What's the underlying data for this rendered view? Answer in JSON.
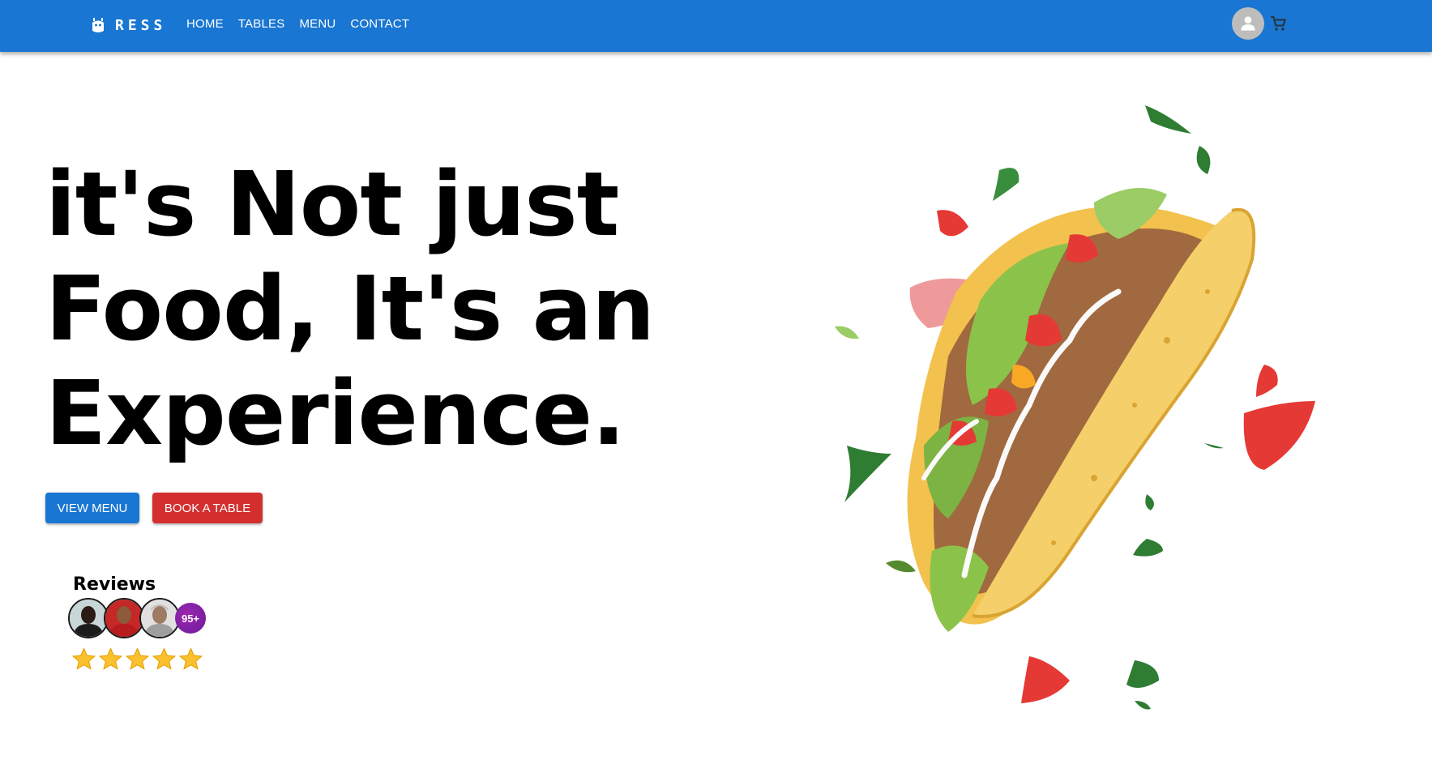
{
  "header": {
    "brand": "RESS",
    "nav": [
      "HOME",
      "TABLES",
      "MENU",
      "CONTACT"
    ],
    "icons": {
      "brand": "logo-bot-icon",
      "account": "account-icon",
      "cart": "cart-icon"
    }
  },
  "hero": {
    "title_lines": [
      "it's Not just",
      "Food, It's an",
      "Experience."
    ],
    "view_menu_label": "VIEW MENU",
    "book_table_label": "BOOK A TABLE"
  },
  "reviews": {
    "title": "Reviews",
    "count_badge": "95+",
    "rating_stars": 5
  },
  "colors": {
    "primary": "#1976d2",
    "danger": "#d32f2f",
    "badge": "#7b1fa2",
    "star": "#fbc02d"
  }
}
